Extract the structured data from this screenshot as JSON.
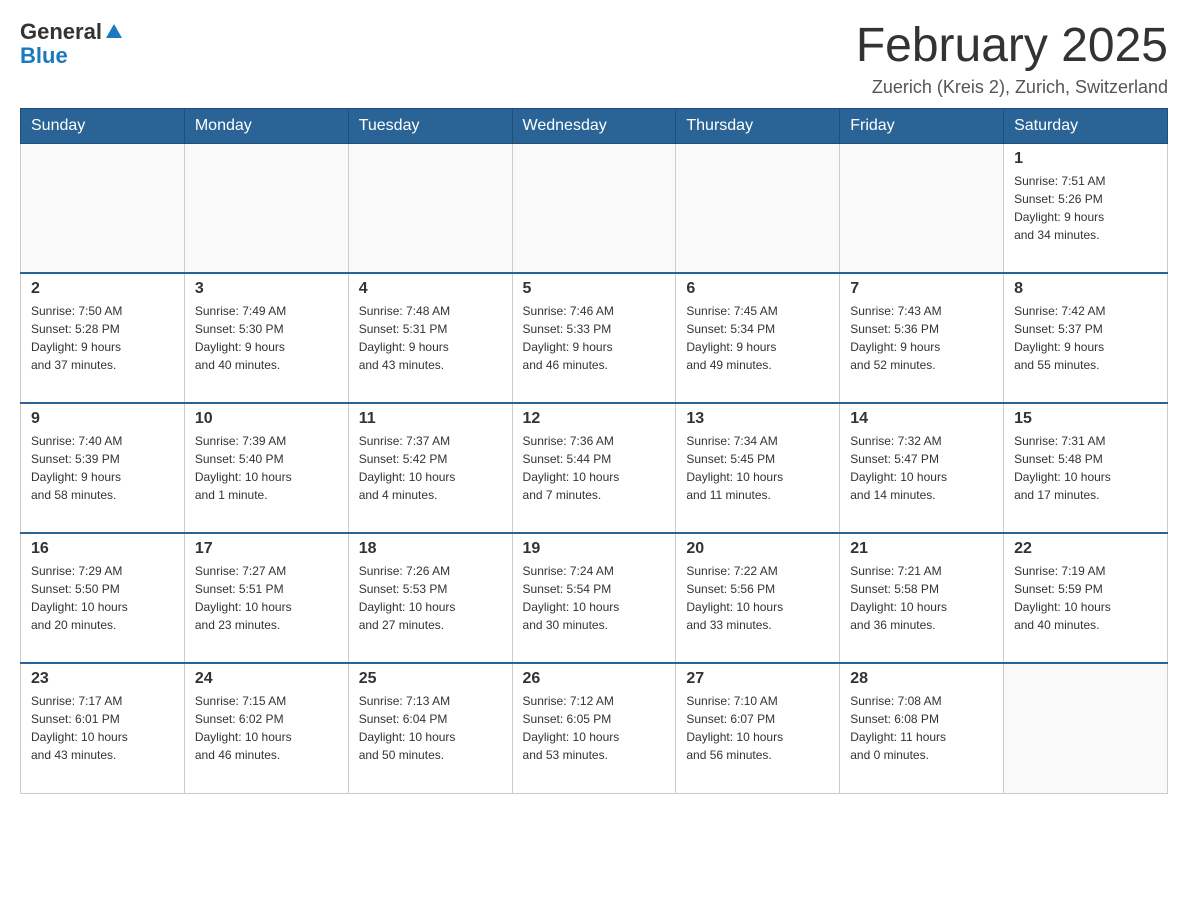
{
  "header": {
    "logo": {
      "general": "General",
      "blue": "Blue",
      "arrow": "▲"
    },
    "title": "February 2025",
    "subtitle": "Zuerich (Kreis 2), Zurich, Switzerland"
  },
  "days_of_week": [
    "Sunday",
    "Monday",
    "Tuesday",
    "Wednesday",
    "Thursday",
    "Friday",
    "Saturday"
  ],
  "weeks": [
    {
      "days": [
        {
          "number": "",
          "info": ""
        },
        {
          "number": "",
          "info": ""
        },
        {
          "number": "",
          "info": ""
        },
        {
          "number": "",
          "info": ""
        },
        {
          "number": "",
          "info": ""
        },
        {
          "number": "",
          "info": ""
        },
        {
          "number": "1",
          "info": "Sunrise: 7:51 AM\nSunset: 5:26 PM\nDaylight: 9 hours\nand 34 minutes."
        }
      ]
    },
    {
      "days": [
        {
          "number": "2",
          "info": "Sunrise: 7:50 AM\nSunset: 5:28 PM\nDaylight: 9 hours\nand 37 minutes."
        },
        {
          "number": "3",
          "info": "Sunrise: 7:49 AM\nSunset: 5:30 PM\nDaylight: 9 hours\nand 40 minutes."
        },
        {
          "number": "4",
          "info": "Sunrise: 7:48 AM\nSunset: 5:31 PM\nDaylight: 9 hours\nand 43 minutes."
        },
        {
          "number": "5",
          "info": "Sunrise: 7:46 AM\nSunset: 5:33 PM\nDaylight: 9 hours\nand 46 minutes."
        },
        {
          "number": "6",
          "info": "Sunrise: 7:45 AM\nSunset: 5:34 PM\nDaylight: 9 hours\nand 49 minutes."
        },
        {
          "number": "7",
          "info": "Sunrise: 7:43 AM\nSunset: 5:36 PM\nDaylight: 9 hours\nand 52 minutes."
        },
        {
          "number": "8",
          "info": "Sunrise: 7:42 AM\nSunset: 5:37 PM\nDaylight: 9 hours\nand 55 minutes."
        }
      ]
    },
    {
      "days": [
        {
          "number": "9",
          "info": "Sunrise: 7:40 AM\nSunset: 5:39 PM\nDaylight: 9 hours\nand 58 minutes."
        },
        {
          "number": "10",
          "info": "Sunrise: 7:39 AM\nSunset: 5:40 PM\nDaylight: 10 hours\nand 1 minute."
        },
        {
          "number": "11",
          "info": "Sunrise: 7:37 AM\nSunset: 5:42 PM\nDaylight: 10 hours\nand 4 minutes."
        },
        {
          "number": "12",
          "info": "Sunrise: 7:36 AM\nSunset: 5:44 PM\nDaylight: 10 hours\nand 7 minutes."
        },
        {
          "number": "13",
          "info": "Sunrise: 7:34 AM\nSunset: 5:45 PM\nDaylight: 10 hours\nand 11 minutes."
        },
        {
          "number": "14",
          "info": "Sunrise: 7:32 AM\nSunset: 5:47 PM\nDaylight: 10 hours\nand 14 minutes."
        },
        {
          "number": "15",
          "info": "Sunrise: 7:31 AM\nSunset: 5:48 PM\nDaylight: 10 hours\nand 17 minutes."
        }
      ]
    },
    {
      "days": [
        {
          "number": "16",
          "info": "Sunrise: 7:29 AM\nSunset: 5:50 PM\nDaylight: 10 hours\nand 20 minutes."
        },
        {
          "number": "17",
          "info": "Sunrise: 7:27 AM\nSunset: 5:51 PM\nDaylight: 10 hours\nand 23 minutes."
        },
        {
          "number": "18",
          "info": "Sunrise: 7:26 AM\nSunset: 5:53 PM\nDaylight: 10 hours\nand 27 minutes."
        },
        {
          "number": "19",
          "info": "Sunrise: 7:24 AM\nSunset: 5:54 PM\nDaylight: 10 hours\nand 30 minutes."
        },
        {
          "number": "20",
          "info": "Sunrise: 7:22 AM\nSunset: 5:56 PM\nDaylight: 10 hours\nand 33 minutes."
        },
        {
          "number": "21",
          "info": "Sunrise: 7:21 AM\nSunset: 5:58 PM\nDaylight: 10 hours\nand 36 minutes."
        },
        {
          "number": "22",
          "info": "Sunrise: 7:19 AM\nSunset: 5:59 PM\nDaylight: 10 hours\nand 40 minutes."
        }
      ]
    },
    {
      "days": [
        {
          "number": "23",
          "info": "Sunrise: 7:17 AM\nSunset: 6:01 PM\nDaylight: 10 hours\nand 43 minutes."
        },
        {
          "number": "24",
          "info": "Sunrise: 7:15 AM\nSunset: 6:02 PM\nDaylight: 10 hours\nand 46 minutes."
        },
        {
          "number": "25",
          "info": "Sunrise: 7:13 AM\nSunset: 6:04 PM\nDaylight: 10 hours\nand 50 minutes."
        },
        {
          "number": "26",
          "info": "Sunrise: 7:12 AM\nSunset: 6:05 PM\nDaylight: 10 hours\nand 53 minutes."
        },
        {
          "number": "27",
          "info": "Sunrise: 7:10 AM\nSunset: 6:07 PM\nDaylight: 10 hours\nand 56 minutes."
        },
        {
          "number": "28",
          "info": "Sunrise: 7:08 AM\nSunset: 6:08 PM\nDaylight: 11 hours\nand 0 minutes."
        },
        {
          "number": "",
          "info": ""
        }
      ]
    }
  ]
}
